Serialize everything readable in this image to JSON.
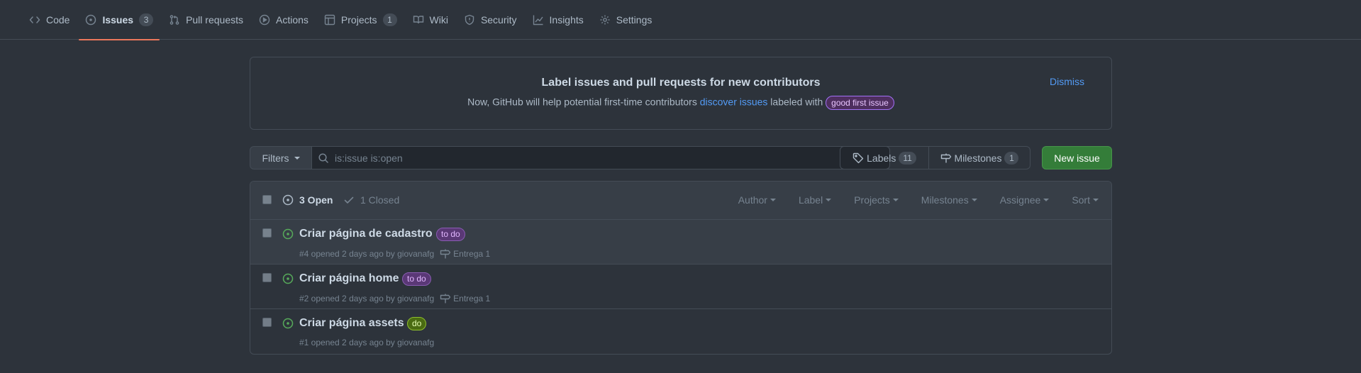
{
  "nav": {
    "items": [
      {
        "label": "Code",
        "icon": "code-icon"
      },
      {
        "label": "Issues",
        "icon": "issue-opened-icon",
        "counter": "3",
        "selected": true
      },
      {
        "label": "Pull requests",
        "icon": "git-pull-request-icon"
      },
      {
        "label": "Actions",
        "icon": "play-icon"
      },
      {
        "label": "Projects",
        "icon": "table-icon",
        "counter": "1"
      },
      {
        "label": "Wiki",
        "icon": "book-icon"
      },
      {
        "label": "Security",
        "icon": "shield-icon"
      },
      {
        "label": "Insights",
        "icon": "graph-icon"
      },
      {
        "label": "Settings",
        "icon": "gear-icon"
      }
    ]
  },
  "banner": {
    "title": "Label issues and pull requests for new contributors",
    "text_before": "Now, GitHub will help potential first-time contributors ",
    "link": "discover issues",
    "text_after": " labeled with ",
    "label": "good first issue",
    "dismiss": "Dismiss"
  },
  "toolbar": {
    "filters": "Filters",
    "search_value": "is:issue is:open",
    "labels": "Labels",
    "labels_count": "11",
    "milestones": "Milestones",
    "milestones_count": "1",
    "new_issue": "New issue"
  },
  "list": {
    "open": "3 Open",
    "closed": "1 Closed",
    "menus": [
      "Author",
      "Label",
      "Projects",
      "Milestones",
      "Assignee",
      "Sort"
    ],
    "issues": [
      {
        "title": "Criar página de cadastro",
        "label": "to do",
        "meta": "#4 opened 2 days ago by giovanafg",
        "milestone": "Entrega 1"
      },
      {
        "title": "Criar página home",
        "label": "to do",
        "meta": "#2 opened 2 days ago by giovanafg",
        "milestone": "Entrega 1"
      },
      {
        "title": "Criar página assets",
        "label": "do",
        "meta": "#1 opened 2 days ago by giovanafg",
        "milestone": ""
      }
    ]
  },
  "colors": {
    "background": "#2d333b",
    "accent_underline": "#ec775c",
    "link": "#539bf5",
    "open_green": "#57ab5a",
    "new_issue_green": "#347d39"
  }
}
